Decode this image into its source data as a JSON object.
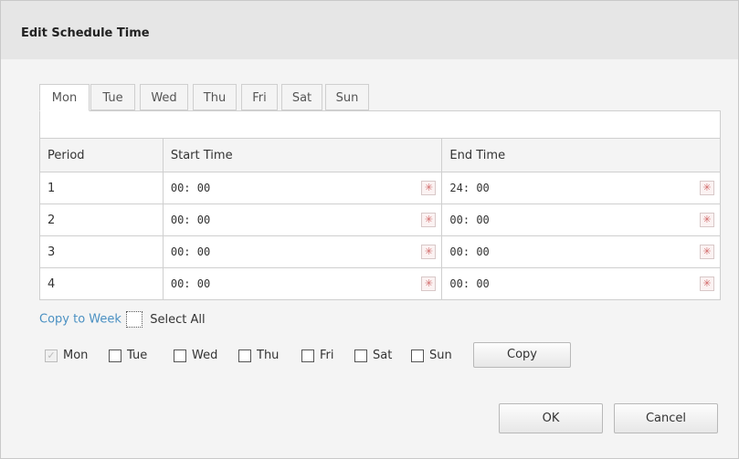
{
  "dialog": {
    "title": "Edit Schedule Time"
  },
  "tabs": [
    {
      "label": "Mon",
      "active": true
    },
    {
      "label": "Tue",
      "active": false
    },
    {
      "label": "Wed",
      "active": false
    },
    {
      "label": "Thu",
      "active": false
    },
    {
      "label": "Fri",
      "active": false
    },
    {
      "label": "Sat",
      "active": false
    },
    {
      "label": "Sun",
      "active": false
    }
  ],
  "table": {
    "headers": [
      "Period",
      "Start Time",
      "End Time"
    ],
    "rows": [
      {
        "period": "1",
        "start": "00: 00",
        "end": "24: 00"
      },
      {
        "period": "2",
        "start": "00: 00",
        "end": "00: 00"
      },
      {
        "period": "3",
        "start": "00: 00",
        "end": "00: 00"
      },
      {
        "period": "4",
        "start": "00: 00",
        "end": "00: 00"
      }
    ]
  },
  "copy_week": {
    "link_label": "Copy to Week",
    "select_all_label": "Select All",
    "select_all_checked": false,
    "days": [
      {
        "label": "Mon",
        "checked": true,
        "disabled": true
      },
      {
        "label": "Tue",
        "checked": false,
        "disabled": false
      },
      {
        "label": "Wed",
        "checked": false,
        "disabled": false
      },
      {
        "label": "Thu",
        "checked": false,
        "disabled": false
      },
      {
        "label": "Fri",
        "checked": false,
        "disabled": false
      },
      {
        "label": "Sat",
        "checked": false,
        "disabled": false
      },
      {
        "label": "Sun",
        "checked": false,
        "disabled": false
      }
    ],
    "copy_label": "Copy"
  },
  "footer": {
    "ok_label": "OK",
    "cancel_label": "Cancel"
  },
  "icons": {
    "time_picker": "clock-picker-icon",
    "check": "checkmark-icon"
  },
  "colors": {
    "title_bar": "#e6e6e6",
    "dialog_bg": "#f4f4f4",
    "link": "#4a90c2",
    "border": "#cfcfcf"
  }
}
